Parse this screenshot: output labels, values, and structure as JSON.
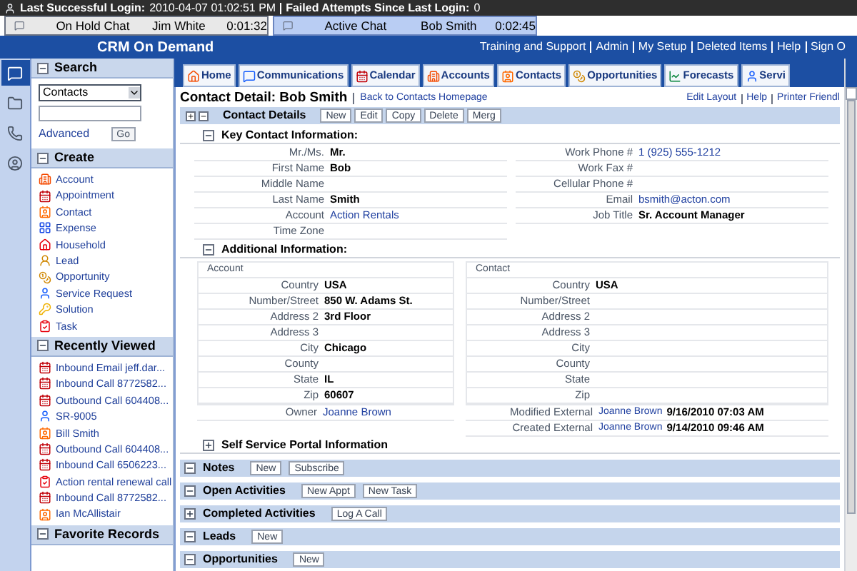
{
  "login_bar": {
    "last_login_label": "Last Successful Login:",
    "last_login": "2010-04-07 01:02:51 PM",
    "failed_label": "Failed Attempts Since Last Login:",
    "failed": "0"
  },
  "chats": [
    {
      "status": "On Hold Chat",
      "name": "Jim White",
      "time": "0:01:32",
      "selected": false
    },
    {
      "status": "Active Chat",
      "name": "Bob Smith",
      "time": "0:02:45",
      "selected": true
    }
  ],
  "header": {
    "product": "CRM On Demand",
    "links": [
      "Training and Support",
      "Admin",
      "My Setup",
      "Deleted Items",
      "Help",
      "Sign O"
    ]
  },
  "rail": [
    {
      "selected": true
    },
    {
      "selected": false
    },
    {
      "selected": false
    },
    {
      "selected": false
    }
  ],
  "tabs": [
    {
      "label": "Home"
    },
    {
      "label": "Communications"
    },
    {
      "label": "Calendar"
    },
    {
      "label": "Accounts"
    },
    {
      "label": "Contacts"
    },
    {
      "label": "Opportunities"
    },
    {
      "label": "Forecasts"
    },
    {
      "label": "Servi"
    }
  ],
  "sidebar": {
    "search": {
      "title": "Search",
      "expanded": true,
      "select_value": "Contacts",
      "advanced": "Advanced",
      "go": "Go"
    },
    "create": {
      "title": "Create",
      "expanded": true,
      "items": [
        {
          "label": "Account",
          "kind": "account"
        },
        {
          "label": "Appointment",
          "kind": "appointment"
        },
        {
          "label": "Contact",
          "kind": "contact"
        },
        {
          "label": "Expense",
          "kind": "expense"
        },
        {
          "label": "Household",
          "kind": "household"
        },
        {
          "label": "Lead",
          "kind": "lead"
        },
        {
          "label": "Opportunity",
          "kind": "opportunity"
        },
        {
          "label": "Service Request",
          "kind": "service_request"
        },
        {
          "label": "Solution",
          "kind": "solution"
        },
        {
          "label": "Task",
          "kind": "task"
        }
      ]
    },
    "recent": {
      "title": "Recently Viewed",
      "expanded": true,
      "items": [
        {
          "label": "Inbound Email jeff.dar...",
          "kind": "appointment"
        },
        {
          "label": "Inbound Call 8772582...",
          "kind": "appointment"
        },
        {
          "label": "Outbound Call 604408...",
          "kind": "appointment"
        },
        {
          "label": "SR-9005",
          "kind": "service_request"
        },
        {
          "label": "Bill Smith",
          "kind": "contact"
        },
        {
          "label": "Outbound Call 604408...",
          "kind": "appointment"
        },
        {
          "label": "Inbound Call 6506223...",
          "kind": "appointment"
        },
        {
          "label": "Action rental renewal call",
          "kind": "task"
        },
        {
          "label": "Inbound Call 8772582...",
          "kind": "appointment"
        },
        {
          "label": "Ian McAllistair",
          "kind": "contact"
        }
      ]
    },
    "favorites": {
      "title": "Favorite Records",
      "expanded": true
    }
  },
  "main": {
    "title": "Contact Detail: Bob Smith",
    "back_link": "Back to Contacts Homepage",
    "links": [
      "Edit Layout",
      "Help",
      "Printer Friendl"
    ],
    "detail_bar": {
      "title": "Contact Details",
      "buttons": [
        "New",
        "Edit",
        "Copy",
        "Delete",
        "Merg"
      ]
    },
    "key_section": {
      "title": "Key Contact Information:",
      "expanded": true,
      "left": [
        {
          "label": "Mr./Ms.",
          "value": "Mr.",
          "kind": "text"
        },
        {
          "label": "First Name",
          "value": "Bob",
          "kind": "text"
        },
        {
          "label": "Middle Name"
        },
        {
          "label": "Last Name",
          "value": "Smith",
          "kind": "text"
        },
        {
          "label": "Account",
          "value": "Action Rentals",
          "kind": "link"
        },
        {
          "label": "Time Zone"
        }
      ],
      "right": [
        {
          "label": "Work Phone #",
          "value": "1 (925) 555-1212",
          "kind": "link"
        },
        {
          "label": "Work Fax #"
        },
        {
          "label": "Cellular Phone #"
        },
        {
          "label": "Email",
          "value": "bsmith@acton.com",
          "kind": "link"
        },
        {
          "label": "Job Title",
          "value": "Sr. Account Manager",
          "kind": "text"
        }
      ]
    },
    "additional": {
      "title": "Additional Information:",
      "expanded": true,
      "account": {
        "title": "Account",
        "rows": [
          {
            "label": "Country",
            "value": "USA"
          },
          {
            "label": "Number/Street",
            "value": "850 W. Adams St."
          },
          {
            "label": "Address 2",
            "value": "3rd Floor"
          },
          {
            "label": "Address 3"
          },
          {
            "label": "City",
            "value": "Chicago"
          },
          {
            "label": "County"
          },
          {
            "label": "State",
            "value": "IL"
          },
          {
            "label": "Zip",
            "value": "60607"
          }
        ]
      },
      "contact": {
        "title": "Contact",
        "rows": [
          {
            "label": "Country",
            "value": "USA"
          },
          {
            "label": "Number/Street"
          },
          {
            "label": "Address 2"
          },
          {
            "label": "Address 3"
          },
          {
            "label": "City"
          },
          {
            "label": "County"
          },
          {
            "label": "State"
          },
          {
            "label": "Zip"
          }
        ]
      },
      "owner": {
        "label": "Owner",
        "value": "Joanne Brown"
      },
      "audit": [
        {
          "label": "Modified External",
          "by": "Joanne Brown",
          "date": "9/16/2010 07:03 AM"
        },
        {
          "label": "Created External",
          "by": "Joanne Brown",
          "date": "9/14/2010 09:46 AM"
        }
      ]
    },
    "self_service": {
      "title": "Self Service Portal Information",
      "expanded": false
    },
    "sections": [
      {
        "title": "Notes",
        "expanded": true,
        "buttons": [
          "New",
          "Subscribe"
        ]
      },
      {
        "title": "Open Activities",
        "expanded": true,
        "buttons": [
          "New Appt",
          "New Task"
        ]
      },
      {
        "title": "Completed Activities",
        "expanded": false,
        "buttons": [
          "Log A Call"
        ]
      },
      {
        "title": "Leads",
        "expanded": true,
        "buttons": [
          "New"
        ]
      },
      {
        "title": "Opportunities",
        "expanded": true,
        "buttons": [
          "New"
        ]
      }
    ]
  }
}
